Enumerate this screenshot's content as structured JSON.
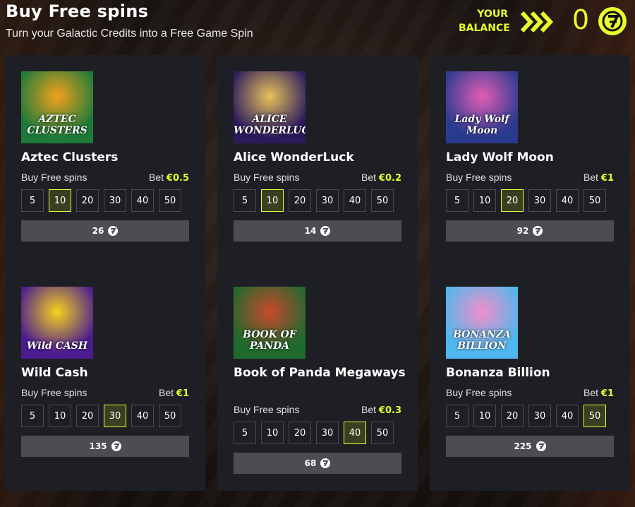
{
  "header": {
    "title": "Buy Free spins",
    "subtitle": "Turn your Galactic Credits into a Free Game Spin",
    "balance_label_line1": "YOUR",
    "balance_label_line2": "BALANCE",
    "balance_value": "0"
  },
  "colors": {
    "accent": "#e8ff2d",
    "card_bg": "#1e1f24",
    "button_bg": "#4c4d53",
    "option_border": "#4a4b52"
  },
  "spin_options": [
    "5",
    "10",
    "20",
    "30",
    "40",
    "50"
  ],
  "cards": [
    {
      "game": "Aztec Clusters",
      "thumb_text": "AZTEC CLUSTERS",
      "buy_label": "Buy Free spins",
      "bet_prefix": "Bet",
      "bet": "€0.5",
      "selected": "10",
      "price": "26",
      "thumb_colors": [
        "#1d7a3a",
        "#f2a11c"
      ]
    },
    {
      "game": "Alice WonderLuck",
      "thumb_text": "ALICE WONDERLUCK",
      "buy_label": "Buy Free spins",
      "bet_prefix": "Bet",
      "bet": "€0.2",
      "selected": "10",
      "price": "14",
      "thumb_colors": [
        "#2b1b5e",
        "#e8c25a"
      ]
    },
    {
      "game": "Lady Wolf Moon",
      "thumb_text": "Lady Wolf Moon",
      "buy_label": "Buy Free spins",
      "bet_prefix": "Bet",
      "bet": "€1",
      "selected": "20",
      "price": "92",
      "thumb_colors": [
        "#2a3b8f",
        "#e35db5"
      ]
    },
    {
      "game": "Wild Cash",
      "thumb_text": "Wild CASH",
      "buy_label": "Buy Free spins",
      "bet_prefix": "Bet",
      "bet": "€1",
      "selected": "30",
      "price": "135",
      "thumb_colors": [
        "#4b1c8f",
        "#f5d21e"
      ]
    },
    {
      "game": "Book of Panda Megaways",
      "thumb_text": "BOOK OF PANDA",
      "buy_label": "Buy Free spins",
      "bet_prefix": "Bet",
      "bet": "€0.3",
      "selected": "40",
      "price": "68",
      "thumb_colors": [
        "#1f6a2f",
        "#c8482a"
      ]
    },
    {
      "game": "Bonanza Billion",
      "thumb_text": "BONANZA BILLION",
      "buy_label": "Buy Free spins",
      "bet_prefix": "Bet",
      "bet": "€1",
      "selected": "50",
      "price": "225",
      "thumb_colors": [
        "#4fb7ee",
        "#f08fc9"
      ]
    }
  ]
}
